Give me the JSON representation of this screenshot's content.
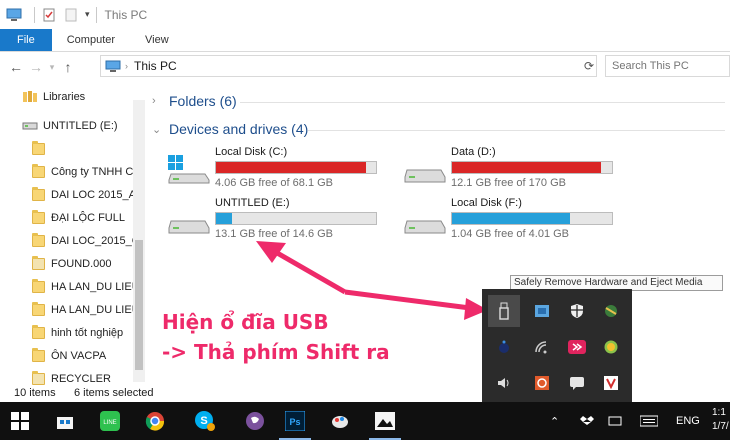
{
  "window": {
    "title": "This PC"
  },
  "ribbon": {
    "tabs": [
      "File",
      "Computer",
      "View"
    ]
  },
  "address": {
    "location": "This PC",
    "search_placeholder": "Search This PC"
  },
  "navpane": {
    "items": [
      {
        "label": "Libraries",
        "type": "library"
      },
      {
        "label": "UNTITLED (E:)",
        "type": "drive"
      },
      {
        "label": "",
        "type": "folder"
      },
      {
        "label": "Công ty TNHH C",
        "type": "folder"
      },
      {
        "label": "DAI LOC 2015_A",
        "type": "folder"
      },
      {
        "label": "ĐẠI LỘC FULL",
        "type": "folder"
      },
      {
        "label": "DAI LOC_2015_C",
        "type": "folder"
      },
      {
        "label": "FOUND.000",
        "type": "folder-plain"
      },
      {
        "label": "HA LAN_DU LIEU",
        "type": "folder"
      },
      {
        "label": "HA LAN_DU LIEU",
        "type": "folder"
      },
      {
        "label": "hinh tốt nghiệp",
        "type": "folder"
      },
      {
        "label": "ÔN VACPA",
        "type": "folder"
      },
      {
        "label": "RECYCLER",
        "type": "folder-plain"
      }
    ]
  },
  "groups": {
    "folders": "Folders (6)",
    "devices": "Devices and drives (4)"
  },
  "drives": [
    {
      "name": "Local Disk (C:)",
      "free": "4.06 GB free of 68.1 GB",
      "used_fraction": 0.94,
      "color": "red",
      "os": true
    },
    {
      "name": "Data (D:)",
      "free": "12.1 GB free of 170 GB",
      "used_fraction": 0.93,
      "color": "red",
      "os": false
    },
    {
      "name": "UNTITLED (E:)",
      "free": "13.1 GB free of 14.6 GB",
      "used_fraction": 0.1,
      "color": "blue",
      "os": false
    },
    {
      "name": "Local Disk (F:)",
      "free": "1.04 GB free of 4.01 GB",
      "used_fraction": 0.74,
      "color": "blue",
      "os": false
    }
  ],
  "status": {
    "count": "10 items",
    "selected": "6 items selected"
  },
  "tooltip": "Safely Remove Hardware and Eject Media",
  "annotation": {
    "line1": "Hiện ổ đĩa USB",
    "line2": "-> Thả phím Shift ra"
  },
  "taskbar": {
    "lang": "ENG",
    "clock_time": "1:1",
    "clock_date": "1/7/"
  },
  "colors": {
    "accent": "#1979ca",
    "annotation": "#ee2a6a",
    "bar_red": "#da2626",
    "bar_blue": "#26a0da"
  }
}
